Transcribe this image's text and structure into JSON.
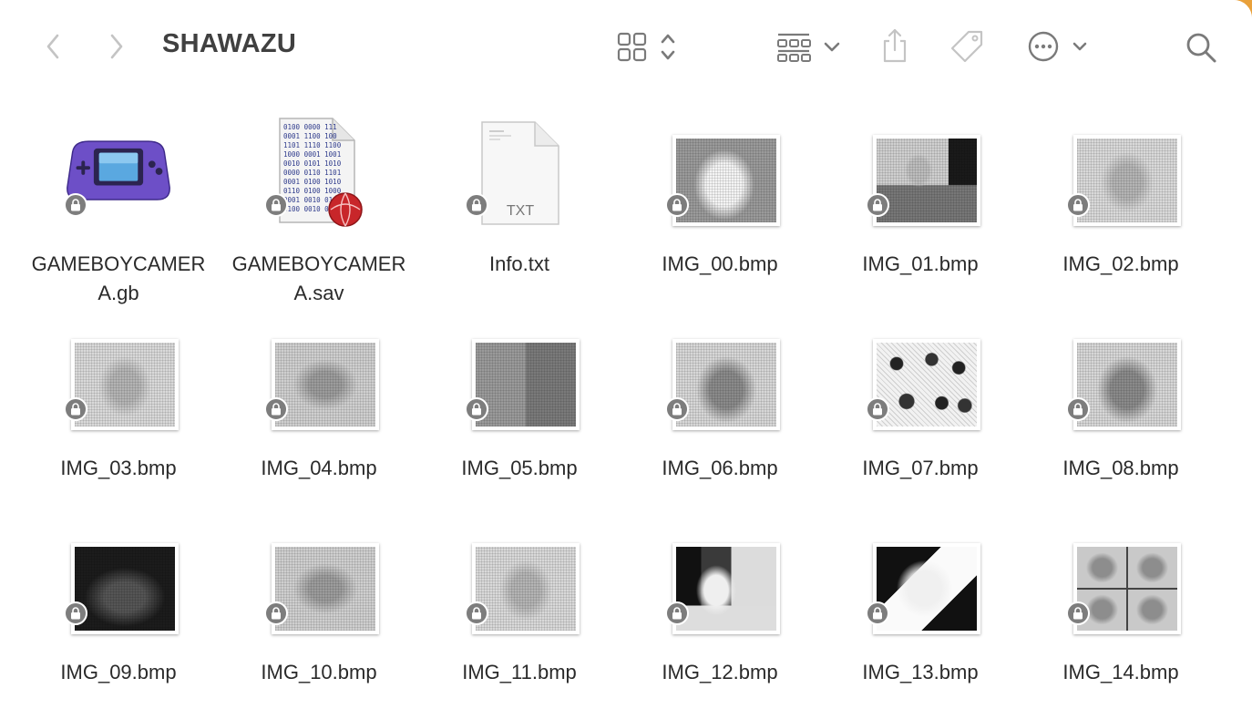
{
  "window": {
    "title": "SHAWAZU"
  },
  "toolbar": {
    "back_icon": "chevron-left-icon",
    "forward_icon": "chevron-right-icon",
    "view_icon": "grid-view-icon",
    "group_icon": "group-icon",
    "share_icon": "share-icon",
    "tag_icon": "tag-icon",
    "more_icon": "ellipsis-circle-icon",
    "search_icon": "search-icon"
  },
  "files": [
    {
      "name": "GAMEBOYCAMERA.gb",
      "label_line1": "GAMEBOYCAMER",
      "label_line2": "A.gb",
      "kind": "gba"
    },
    {
      "name": "GAMEBOYCAMERA.sav",
      "label_line1": "GAMEBOYCAMER",
      "label_line2": "A.sav",
      "kind": "sav"
    },
    {
      "name": "Info.txt",
      "label_line1": "Info.txt",
      "label_line2": "",
      "kind": "txt",
      "badge": "TXT"
    },
    {
      "name": "IMG_00.bmp",
      "label_line1": "IMG_00.bmp",
      "label_line2": "",
      "kind": "bmp",
      "tone": "face-light"
    },
    {
      "name": "IMG_01.bmp",
      "label_line1": "IMG_01.bmp",
      "label_line2": "",
      "kind": "bmp",
      "tone": "person"
    },
    {
      "name": "IMG_02.bmp",
      "label_line1": "IMG_02.bmp",
      "label_line2": "",
      "kind": "bmp",
      "tone": "face-pale"
    },
    {
      "name": "IMG_03.bmp",
      "label_line1": "IMG_03.bmp",
      "label_line2": "",
      "kind": "bmp",
      "tone": "face-pale"
    },
    {
      "name": "IMG_04.bmp",
      "label_line1": "IMG_04.bmp",
      "label_line2": "",
      "kind": "bmp",
      "tone": "mirror"
    },
    {
      "name": "IMG_05.bmp",
      "label_line1": "IMG_05.bmp",
      "label_line2": "",
      "kind": "bmp",
      "tone": "split"
    },
    {
      "name": "IMG_06.bmp",
      "label_line1": "IMG_06.bmp",
      "label_line2": "",
      "kind": "bmp",
      "tone": "face-dark"
    },
    {
      "name": "IMG_07.bmp",
      "label_line1": "IMG_07.bmp",
      "label_line2": "",
      "kind": "bmp",
      "tone": "sprites"
    },
    {
      "name": "IMG_08.bmp",
      "label_line1": "IMG_08.bmp",
      "label_line2": "",
      "kind": "bmp",
      "tone": "face-dark"
    },
    {
      "name": "IMG_09.bmp",
      "label_line1": "IMG_09.bmp",
      "label_line2": "",
      "kind": "bmp",
      "tone": "dark"
    },
    {
      "name": "IMG_10.bmp",
      "label_line1": "IMG_10.bmp",
      "label_line2": "",
      "kind": "bmp",
      "tone": "mirror"
    },
    {
      "name": "IMG_11.bmp",
      "label_line1": "IMG_11.bmp",
      "label_line2": "",
      "kind": "bmp",
      "tone": "face-pale"
    },
    {
      "name": "IMG_12.bmp",
      "label_line1": "IMG_12.bmp",
      "label_line2": "",
      "kind": "bmp",
      "tone": "woman"
    },
    {
      "name": "IMG_13.bmp",
      "label_line1": "IMG_13.bmp",
      "label_line2": "",
      "kind": "bmp",
      "tone": "man"
    },
    {
      "name": "IMG_14.bmp",
      "label_line1": "IMG_14.bmp",
      "label_line2": "",
      "kind": "bmp",
      "tone": "quad"
    }
  ],
  "colors": {
    "accent": "#e9a13b",
    "toolbar_icon": "#7a7a7a",
    "lock_badge": "#7d7d7d",
    "gba_purple": "#6d4fc7"
  }
}
